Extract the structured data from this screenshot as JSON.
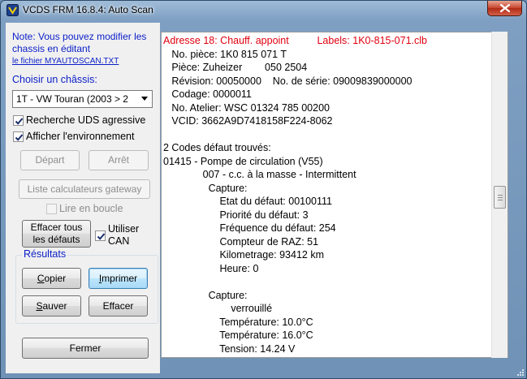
{
  "window": {
    "title": "VCDS FRM 16.8.4:  Auto Scan",
    "close_icon": "close-icon",
    "app_icon": "vcds-app-icon"
  },
  "left": {
    "note": "Note:  Vous pouvez modifier les chassis en éditant",
    "note_link": "le fichier MYAUTOSCAN.TXT",
    "chassis_label": "Choisir un châssis:",
    "chassis_value": "1T - VW Touran (2003 > 2",
    "uds_label": "Recherche UDS agressive",
    "env_label": "Afficher l'environnement",
    "start_label": "Départ",
    "stop_label": "Arrêt",
    "gateway_label": "Liste calculateurs gateway",
    "loop_label": "Lire en boucle",
    "clear_all_label_1": "Effacer tous",
    "clear_all_label_2": "les défauts",
    "can_label_1": "Utiliser",
    "can_label_2": "CAN",
    "results_label": "Résultats",
    "copy_label": "opier",
    "copy_key": "C",
    "print_label": "mprimer",
    "print_key": "I",
    "save_label": "auver",
    "save_key": "S",
    "erase_label": "Effacer",
    "close_label": "Fermer"
  },
  "output": {
    "lines": [
      "Adresse 18: Chauff. appoint          Labels: 1K0-815-071.clb",
      "   No. pièce: 1K0 815 071 T",
      "   Pièce: Zuheizer        050 2504",
      "   Révision: 00050000    No. de série: 09009839000000",
      "   Codage: 0000011",
      "   No. Atelier: WSC 01324 785 00200",
      "   VCID: 3662A9D7418158F224-8062",
      "",
      "2 Codes défaut trouvés:",
      "01415 - Pompe de circulation (V55)",
      "              007 - c.c. à la masse - Intermittent",
      "                Capture:",
      "                    Etat du défaut: 00100111",
      "                    Priorité du défaut: 3",
      "                    Fréquence du défaut: 254",
      "                    Compteur de RAZ: 51",
      "                    Kilometrage: 93412 km",
      "                    Heure: 0",
      "",
      "                Capture:",
      "                        verrouillé",
      "                    Température: 10.0°C",
      "                    Température: 16.0°C",
      "                    Tension: 14.24 V"
    ]
  },
  "colors": {
    "accent_text": "#0a1ec8",
    "address_line": "#e0000f"
  }
}
